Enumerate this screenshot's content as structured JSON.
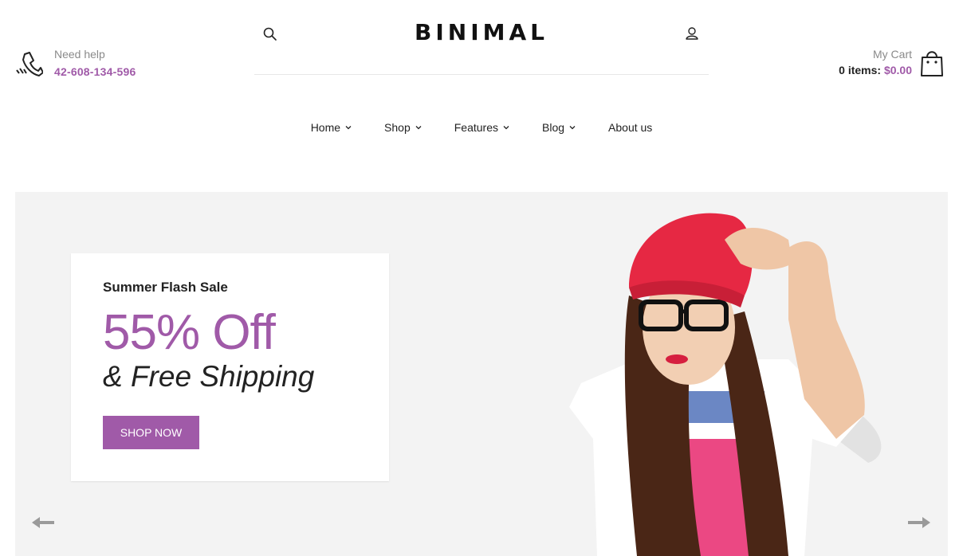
{
  "header": {
    "help_label": "Need help",
    "phone": "42-608-134-596",
    "logo": "BINIMAL",
    "cart": {
      "label": "My Cart",
      "items_text": "0 items:",
      "amount": "$0.00"
    }
  },
  "nav": {
    "items": [
      {
        "label": "Home",
        "has_dropdown": true
      },
      {
        "label": "Shop",
        "has_dropdown": true
      },
      {
        "label": "Features",
        "has_dropdown": true
      },
      {
        "label": "Blog",
        "has_dropdown": true
      },
      {
        "label": "About us",
        "has_dropdown": false
      }
    ]
  },
  "hero": {
    "kicker": "Summer Flash Sale",
    "headline": "55% Off",
    "subheadline": "& Free Shipping",
    "cta_label": "SHOP NOW"
  },
  "icons": {
    "phone": "phone-icon",
    "search": "search-icon",
    "user": "user-icon",
    "cart": "shopping-bag-icon",
    "prev": "arrow-left-icon",
    "next": "arrow-right-icon"
  },
  "colors": {
    "accent": "#a05aa8",
    "hero_bg": "#f3f3f3",
    "text": "#222222",
    "muted": "#8a8a8a"
  }
}
